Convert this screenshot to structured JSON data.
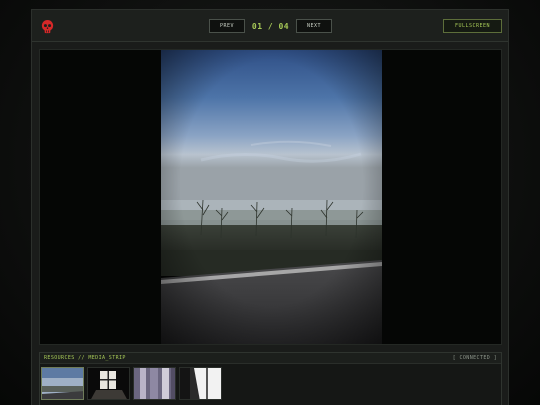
{
  "toolbar": {
    "prev_label": "PREV",
    "counter": "01 / 04",
    "next_label": "NEXT",
    "fullscreen_label": "FULLSCREEN",
    "logo_icon": "skull-icon"
  },
  "strip": {
    "title": "RESOURCES // MEDIA_STRIP",
    "status": "[ CONNECTED ]"
  },
  "colors": {
    "accent": "#a7c957",
    "logo": "#d62828",
    "background": "#0c0d0c"
  },
  "thumbnails": [
    {
      "icon": "foggy-road-thumbnail",
      "active": true
    },
    {
      "icon": "window-thumbnail",
      "active": false
    },
    {
      "icon": "curtain-thumbnail",
      "active": false
    },
    {
      "icon": "bright-window-thumbnail",
      "active": false
    }
  ]
}
